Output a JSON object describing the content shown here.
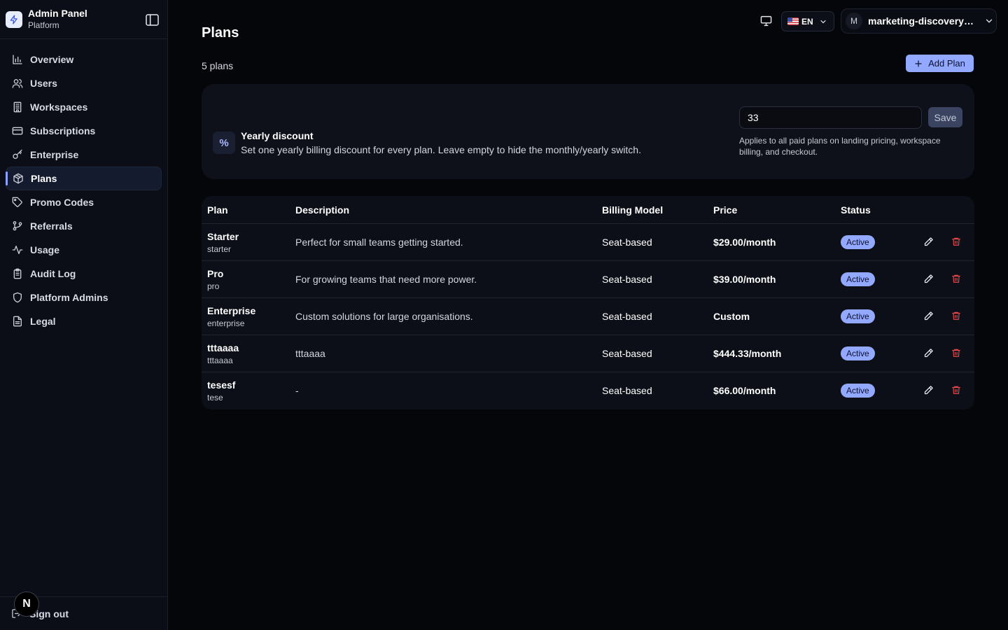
{
  "brand": {
    "title": "Admin Panel",
    "subtitle": "Platform"
  },
  "sidebar": {
    "items": [
      {
        "label": "Overview",
        "icon": "bar-chart-icon"
      },
      {
        "label": "Users",
        "icon": "users-icon"
      },
      {
        "label": "Workspaces",
        "icon": "building-icon"
      },
      {
        "label": "Subscriptions",
        "icon": "credit-card-icon"
      },
      {
        "label": "Enterprise",
        "icon": "key-icon"
      },
      {
        "label": "Plans",
        "icon": "package-icon",
        "active": true
      },
      {
        "label": "Promo Codes",
        "icon": "tag-icon"
      },
      {
        "label": "Referrals",
        "icon": "git-branch-icon"
      },
      {
        "label": "Usage",
        "icon": "activity-icon"
      },
      {
        "label": "Audit Log",
        "icon": "clipboard-icon"
      },
      {
        "label": "Platform Admins",
        "icon": "shield-icon"
      },
      {
        "label": "Legal",
        "icon": "file-text-icon"
      }
    ],
    "signout": "Sign out",
    "next_badge": "N"
  },
  "topbar": {
    "lang": "EN",
    "user_initial": "M",
    "user_email": "marketing-discovery@l..."
  },
  "page": {
    "title": "Plans",
    "count": "5 plans",
    "add_button": "Add Plan"
  },
  "discount": {
    "title": "Yearly discount",
    "description": "Set one yearly billing discount for every plan. Leave empty to hide the monthly/yearly switch.",
    "value": "33",
    "save": "Save",
    "note": "Applies to all paid plans on landing pricing, workspace billing, and checkout.",
    "icon_glyph": "%"
  },
  "table": {
    "headers": {
      "plan": "Plan",
      "description": "Description",
      "billing": "Billing Model",
      "price": "Price",
      "status": "Status"
    },
    "rows": [
      {
        "name": "Starter",
        "slug": "starter",
        "description": "Perfect for small teams getting started.",
        "billing": "Seat-based",
        "price": "$29.00/month",
        "status": "Active"
      },
      {
        "name": "Pro",
        "slug": "pro",
        "description": "For growing teams that need more power.",
        "billing": "Seat-based",
        "price": "$39.00/month",
        "status": "Active"
      },
      {
        "name": "Enterprise",
        "slug": "enterprise",
        "description": "Custom solutions for large organisations.",
        "billing": "Seat-based",
        "price": "Custom",
        "status": "Active"
      },
      {
        "name": "tttaaaa",
        "slug": "tttaaaa",
        "description": "tttaaaa",
        "billing": "Seat-based",
        "price": "$444.33/month",
        "status": "Active"
      },
      {
        "name": "tesesf",
        "slug": "tese",
        "description": "-",
        "billing": "Seat-based",
        "price": "$66.00/month",
        "status": "Active"
      }
    ]
  },
  "colors": {
    "accent": "#93a9ff",
    "danger": "#e5484d",
    "background": "#05060a",
    "sidebar": "#0b0e16"
  }
}
